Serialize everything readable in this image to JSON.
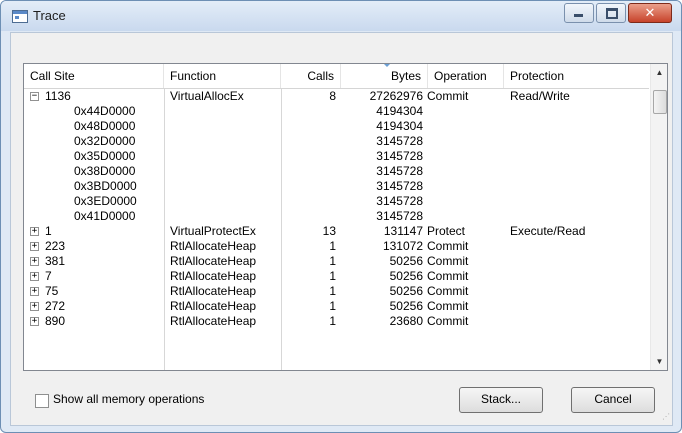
{
  "window": {
    "title": "Trace"
  },
  "table": {
    "headers": [
      "Call Site",
      "Function",
      "Calls",
      "Bytes",
      "Operation",
      "Protection"
    ],
    "rows": [
      {
        "expander": "−",
        "call_site": "1136",
        "function": "VirtualAllocEx",
        "calls": "8",
        "bytes": "27262976",
        "operation": "Commit",
        "protection": "Read/Write"
      },
      {
        "expander": "",
        "call_site": "0x44D0000",
        "function": "",
        "calls": "",
        "bytes": "4194304",
        "operation": "",
        "protection": ""
      },
      {
        "expander": "",
        "call_site": "0x48D0000",
        "function": "",
        "calls": "",
        "bytes": "4194304",
        "operation": "",
        "protection": ""
      },
      {
        "expander": "",
        "call_site": "0x32D0000",
        "function": "",
        "calls": "",
        "bytes": "3145728",
        "operation": "",
        "protection": ""
      },
      {
        "expander": "",
        "call_site": "0x35D0000",
        "function": "",
        "calls": "",
        "bytes": "3145728",
        "operation": "",
        "protection": ""
      },
      {
        "expander": "",
        "call_site": "0x38D0000",
        "function": "",
        "calls": "",
        "bytes": "3145728",
        "operation": "",
        "protection": ""
      },
      {
        "expander": "",
        "call_site": "0x3BD0000",
        "function": "",
        "calls": "",
        "bytes": "3145728",
        "operation": "",
        "protection": ""
      },
      {
        "expander": "",
        "call_site": "0x3ED0000",
        "function": "",
        "calls": "",
        "bytes": "3145728",
        "operation": "",
        "protection": ""
      },
      {
        "expander": "",
        "call_site": "0x41D0000",
        "function": "",
        "calls": "",
        "bytes": "3145728",
        "operation": "",
        "protection": ""
      },
      {
        "expander": "+",
        "call_site": "1",
        "function": "VirtualProtectEx",
        "calls": "13",
        "bytes": "131147",
        "operation": "Protect",
        "protection": "Execute/Read"
      },
      {
        "expander": "+",
        "call_site": "223",
        "function": "RtlAllocateHeap",
        "calls": "1",
        "bytes": "131072",
        "operation": "Commit",
        "protection": ""
      },
      {
        "expander": "+",
        "call_site": "381",
        "function": "RtlAllocateHeap",
        "calls": "1",
        "bytes": "50256",
        "operation": "Commit",
        "protection": ""
      },
      {
        "expander": "+",
        "call_site": "7",
        "function": "RtlAllocateHeap",
        "calls": "1",
        "bytes": "50256",
        "operation": "Commit",
        "protection": ""
      },
      {
        "expander": "+",
        "call_site": "75",
        "function": "RtlAllocateHeap",
        "calls": "1",
        "bytes": "50256",
        "operation": "Commit",
        "protection": ""
      },
      {
        "expander": "+",
        "call_site": "272",
        "function": "RtlAllocateHeap",
        "calls": "1",
        "bytes": "50256",
        "operation": "Commit",
        "protection": ""
      },
      {
        "expander": "+",
        "call_site": "890",
        "function": "RtlAllocateHeap",
        "calls": "1",
        "bytes": "23680",
        "operation": "Commit",
        "protection": ""
      }
    ]
  },
  "options": {
    "show_all_label": "Show all memory operations",
    "show_all_checked": false
  },
  "buttons": {
    "stack": "Stack...",
    "cancel": "Cancel"
  },
  "icons": {
    "title": "window-icon",
    "minimize": "minimize-icon",
    "maximize": "maximize-icon",
    "close": "close-icon",
    "sort": "sort-descending-icon",
    "scroll_up": "scroll-up-icon",
    "scroll_down": "scroll-down-icon",
    "expand": "expand-icon",
    "collapse": "collapse-icon",
    "grip": "resize-grip-icon"
  },
  "colors": {
    "title_bar": "#dfe9f5",
    "close_button": "#c7432b",
    "sort_indicator": "#6b9fd4"
  }
}
